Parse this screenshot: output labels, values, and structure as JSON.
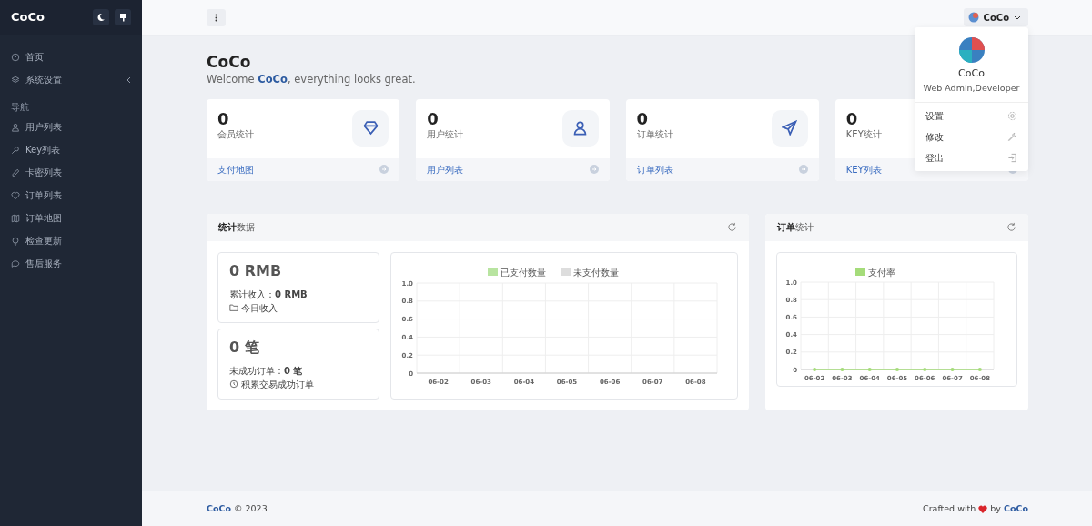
{
  "sidebar": {
    "brand": "CoCo",
    "items": [
      {
        "kind": "link",
        "label": "首页"
      },
      {
        "kind": "submenu",
        "label": "系统设置"
      },
      {
        "kind": "heading",
        "label": "导航"
      },
      {
        "kind": "link",
        "label": "用户列表"
      },
      {
        "kind": "link",
        "label": "Key列表"
      },
      {
        "kind": "link",
        "label": "卡密列表"
      },
      {
        "kind": "link",
        "label": "订单列表"
      },
      {
        "kind": "link",
        "label": "订单地图"
      },
      {
        "kind": "link",
        "label": "检查更新"
      },
      {
        "kind": "link",
        "label": "售后服务"
      }
    ]
  },
  "topbar": {
    "user": "CoCo"
  },
  "user_menu": {
    "name": "CoCo",
    "role": "Web Admin,Developer",
    "items": [
      {
        "label": "设置"
      },
      {
        "label": "修改"
      },
      {
        "label": "登出"
      }
    ]
  },
  "page": {
    "title": "CoCo",
    "welcome": "Welcome **CoCo**, everything looks great."
  },
  "stat_cards": [
    {
      "value": "0",
      "label": "会员统计",
      "link": "支付地图"
    },
    {
      "value": "0",
      "label": "用户统计",
      "link": "用户列表"
    },
    {
      "value": "0",
      "label": "订单统计",
      "link": "订单列表"
    },
    {
      "value": "0",
      "label": "KEY统计",
      "link": "KEY列表"
    }
  ],
  "stats_panel": {
    "title": "**统计**数据",
    "boxes": [
      {
        "value": "0 RMB",
        "detail": "累计收入：**0 RMB**",
        "note": "今日收入"
      },
      {
        "value": "0 笔",
        "detail": "未成功订单：**0 笔**",
        "note": "积累交易成功订单"
      }
    ],
    "chart_data": {
      "type": "bar",
      "categories": [
        "06-02",
        "06-03",
        "06-04",
        "06-05",
        "06-06",
        "06-07",
        "06-08"
      ],
      "series": [
        {
          "name": "已支付数量",
          "color": "#b8e4a0",
          "values": [
            0,
            0,
            0,
            0,
            0,
            0,
            0
          ]
        },
        {
          "name": "未支付数量",
          "color": "#dddddd",
          "values": [
            0,
            0,
            0,
            0,
            0,
            0,
            0
          ]
        }
      ],
      "ylim": [
        0,
        1
      ],
      "grid": true,
      "yticks": [
        {
          "value": 0,
          "label": "0"
        },
        {
          "value": 0.2,
          "label": "0.2"
        },
        {
          "value": 0.4,
          "label": "0.4"
        },
        {
          "value": 0.6,
          "label": "0.6"
        },
        {
          "value": 0.8,
          "label": "0.8"
        },
        {
          "value": 1,
          "label": "1.0"
        }
      ]
    }
  },
  "orders_panel": {
    "title": "**订单**统计",
    "chart_data": {
      "type": "line",
      "categories": [
        "06-02",
        "06-03",
        "06-04",
        "06-05",
        "06-06",
        "06-07",
        "06-08"
      ],
      "series": [
        {
          "name": "支付率",
          "color": "#a5dc7a",
          "values": [
            0,
            0,
            0,
            0,
            0,
            0,
            0
          ]
        }
      ],
      "ylim": [
        0,
        1
      ],
      "grid": true,
      "yticks": [
        {
          "value": 0,
          "label": "0"
        },
        {
          "value": 0.2,
          "label": "0.2"
        },
        {
          "value": 0.4,
          "label": "0.4"
        },
        {
          "value": 0.6,
          "label": "0.6"
        },
        {
          "value": 0.8,
          "label": "0.8"
        },
        {
          "value": 1,
          "label": "1.0"
        }
      ]
    }
  },
  "footer": {
    "brand": "CoCo",
    "copyright": "© 2023",
    "crafted": "Crafted with",
    "by": "by",
    "author": "CoCo"
  }
}
